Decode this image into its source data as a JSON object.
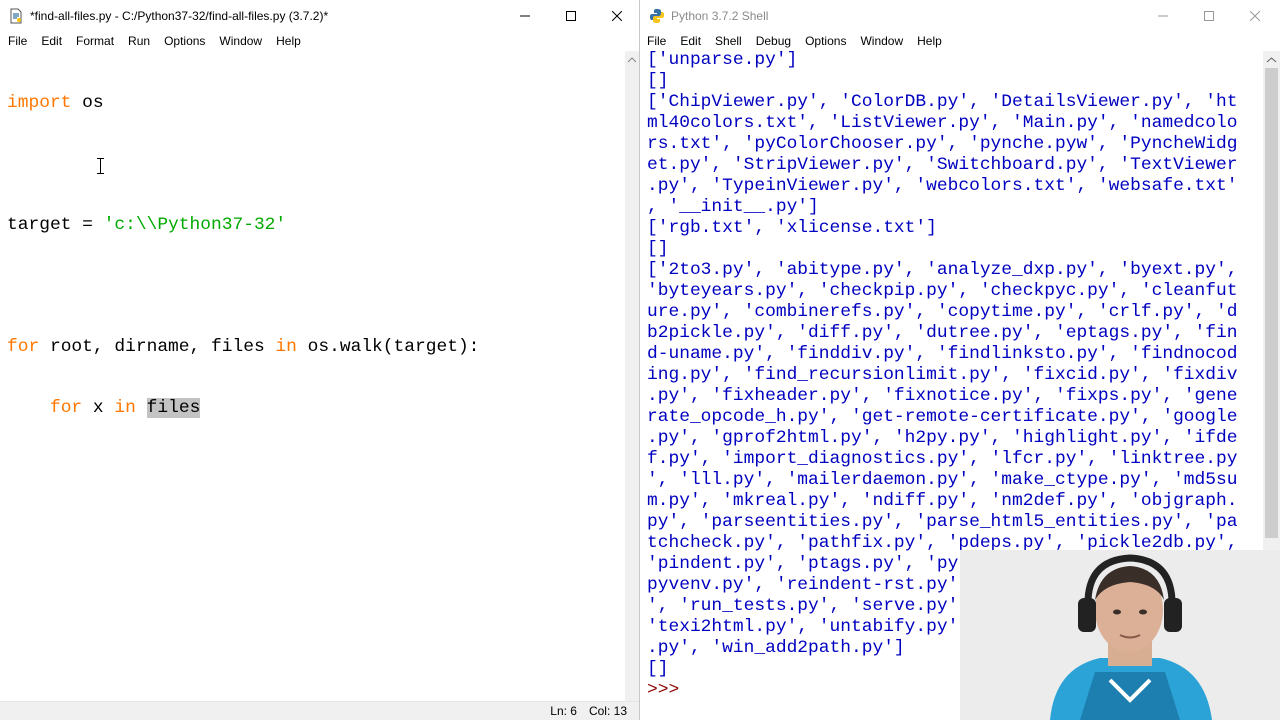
{
  "editor": {
    "title": "*find-all-files.py - C:/Python37-32/find-all-files.py (3.7.2)*",
    "menu": [
      "File",
      "Edit",
      "Format",
      "Run",
      "Options",
      "Window",
      "Help"
    ],
    "code": {
      "l1_kw": "import",
      "l1_rest": " os",
      "l3_a": "target = ",
      "l3_str": "'c:\\\\Python37-32'",
      "l5_kw1": "for",
      "l5_mid": " root, dirname, files ",
      "l5_kw2": "in",
      "l5_rest": " os.walk(target):",
      "l6_indent": "    ",
      "l6_kw1": "for",
      "l6_mid": " x ",
      "l6_kw2": "in",
      "l6_sp": " ",
      "l6_sel": "files"
    },
    "status": {
      "line": "Ln: 6",
      "col": "Col: 13"
    }
  },
  "shell": {
    "title": "Python 3.7.2 Shell",
    "menu": [
      "File",
      "Edit",
      "Shell",
      "Debug",
      "Options",
      "Window",
      "Help"
    ],
    "lines": [
      "['unparse.py']",
      "[]",
      "['ChipViewer.py', 'ColorDB.py', 'DetailsViewer.py', 'ht",
      "ml40colors.txt', 'ListViewer.py', 'Main.py', 'namedcolo",
      "rs.txt', 'pyColorChooser.py', 'pynche.pyw', 'PyncheWidg",
      "et.py', 'StripViewer.py', 'Switchboard.py', 'TextViewer",
      ".py', 'TypeinViewer.py', 'webcolors.txt', 'websafe.txt'",
      ", '__init__.py']",
      "['rgb.txt', 'xlicense.txt']",
      "[]",
      "['2to3.py', 'abitype.py', 'analyze_dxp.py', 'byext.py',",
      "'byteyears.py', 'checkpip.py', 'checkpyc.py', 'cleanfut",
      "ure.py', 'combinerefs.py', 'copytime.py', 'crlf.py', 'd",
      "b2pickle.py', 'diff.py', 'dutree.py', 'eptags.py', 'fin",
      "d-uname.py', 'finddiv.py', 'findlinksto.py', 'findnocod",
      "ing.py', 'find_recursionlimit.py', 'fixcid.py', 'fixdiv",
      ".py', 'fixheader.py', 'fixnotice.py', 'fixps.py', 'gene",
      "rate_opcode_h.py', 'get-remote-certificate.py', 'google",
      ".py', 'gprof2html.py', 'h2py.py', 'highlight.py', 'ifde",
      "f.py', 'import_diagnostics.py', 'lfcr.py', 'linktree.py",
      "', 'lll.py', 'mailerdaemon.py', 'make_ctype.py', 'md5su",
      "m.py', 'mkreal.py', 'ndiff.py', 'nm2def.py', 'objgraph.",
      "py', 'parseentities.py', 'parse_html5_entities.py', 'pa",
      "tchcheck.py', 'pathfix.py', 'pdeps.py', 'pickle2db.py',",
      "'pindent.py', 'ptags.py', 'py",
      "pyvenv.py', 'reindent-rst.py'",
      "', 'run_tests.py', 'serve.py'",
      "'texi2html.py', 'untabify.py'",
      ".py', 'win_add2path.py']",
      "[]"
    ],
    "prompt": ">>> "
  }
}
